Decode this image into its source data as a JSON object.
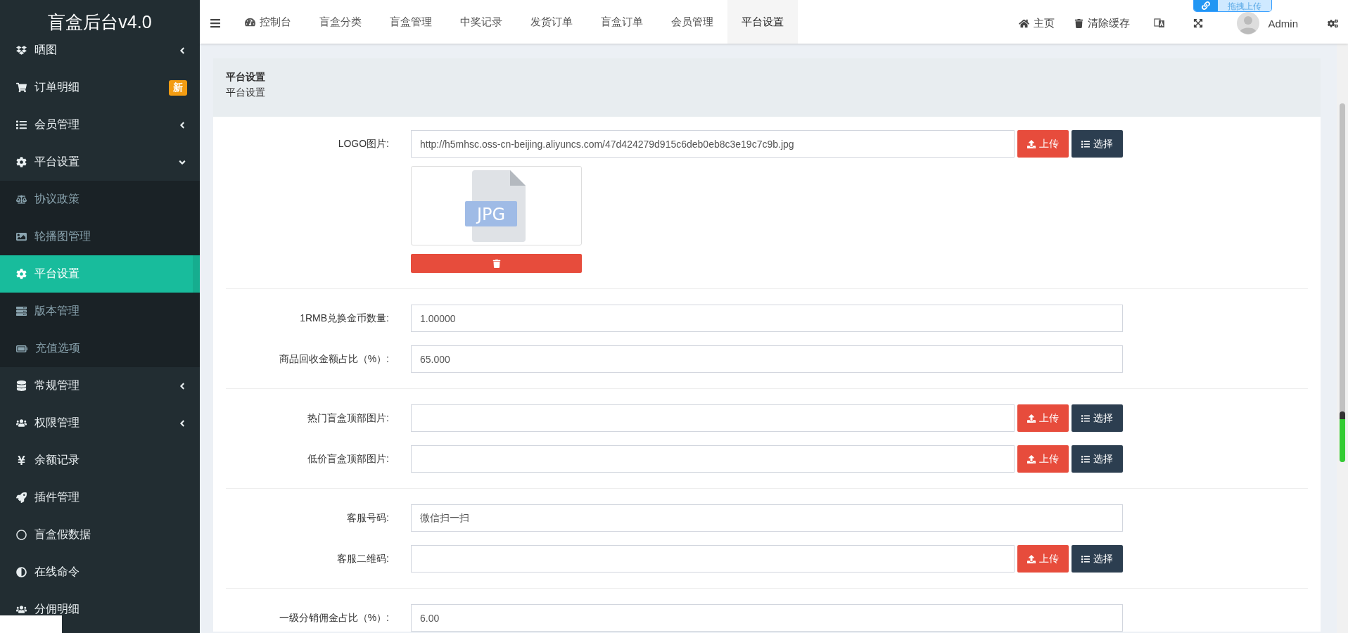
{
  "sidebar": {
    "title": "盲盒后台v4.0",
    "items": [
      {
        "label": "晒图",
        "expanded": false,
        "selected": false
      },
      {
        "label": "订单明细",
        "badge": "新",
        "selected": false
      },
      {
        "label": "会员管理",
        "expanded": false,
        "selected": false
      },
      {
        "label": "平台设置",
        "expanded": true,
        "selected": false,
        "children": [
          {
            "label": "协议政策",
            "selected": false
          },
          {
            "label": "轮播图管理",
            "selected": false
          },
          {
            "label": "平台设置",
            "selected": true
          },
          {
            "label": "版本管理",
            "selected": false
          },
          {
            "label": "充值选项",
            "selected": false
          }
        ]
      },
      {
        "label": "常规管理",
        "expanded": false,
        "selected": false
      },
      {
        "label": "权限管理",
        "expanded": false,
        "selected": false
      },
      {
        "label": "余额记录",
        "selected": false
      },
      {
        "label": "插件管理",
        "selected": false
      },
      {
        "label": "盲盒假数据",
        "selected": false
      },
      {
        "label": "在线命令",
        "selected": false
      },
      {
        "label": "分佣明细",
        "selected": false
      }
    ]
  },
  "topbar": {
    "tabs": [
      {
        "label": "控制台",
        "selected": false
      },
      {
        "label": "盲盒分类",
        "selected": false
      },
      {
        "label": "盲盒管理",
        "selected": false
      },
      {
        "label": "中奖记录",
        "selected": false
      },
      {
        "label": "发货订单",
        "selected": false
      },
      {
        "label": "盲盒订单",
        "selected": false
      },
      {
        "label": "会员管理",
        "selected": false
      },
      {
        "label": "平台设置",
        "selected": true
      }
    ],
    "home": "主页",
    "clear_cache": "清除缓存",
    "user": "Admin",
    "upload_badge": "拖拽上传"
  },
  "panel": {
    "title": "平台设置",
    "subtitle": "平台设置",
    "groups": [
      [
        {
          "kind": "upload",
          "label": "LOGO图片:",
          "value": "http://h5mhsc.oss-cn-beijing.aliyuncs.com/47d424279d915c6deb0eb8c3e19c7c9b.jpg",
          "upload": "上传",
          "choose": "选择",
          "preview": {
            "file_type": "JPG"
          }
        }
      ],
      [
        {
          "kind": "text",
          "label": "1RMB兑换金币数量:",
          "value": "1.00000"
        },
        {
          "kind": "text",
          "label": "商品回收金额占比（%）:",
          "value": "65.000"
        }
      ],
      [
        {
          "kind": "upload",
          "label": "热门盲盒顶部图片:",
          "upload": "上传",
          "choose": "选择"
        },
        {
          "kind": "upload",
          "label": "低价盲盒顶部图片:",
          "upload": "上传",
          "choose": "选择"
        }
      ],
      [
        {
          "kind": "text",
          "label": "客服号码:",
          "value": "微信扫一扫"
        },
        {
          "kind": "upload",
          "label": "客服二维码:",
          "upload": "上传",
          "choose": "选择"
        }
      ],
      [
        {
          "kind": "text",
          "label": "一级分销佣金占比（%）:",
          "value": "6.00"
        }
      ]
    ]
  }
}
